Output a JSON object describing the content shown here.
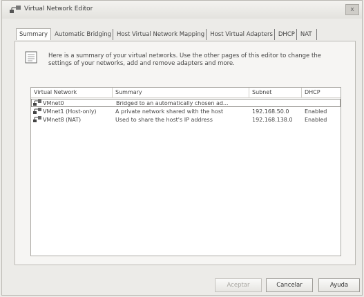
{
  "window": {
    "title": "Virtual Network Editor",
    "close_label": "x"
  },
  "tabs": [
    "Summary",
    "Automatic Bridging",
    "Host Virtual Network Mapping",
    "Host Virtual Adapters",
    "DHCP",
    "NAT"
  ],
  "intro": "Here is a summary of your virtual networks. Use the other pages of this editor to change the settings of your networks, add and remove adapters and more.",
  "table": {
    "headers": [
      "Virtual Network",
      "Summary",
      "Subnet",
      "DHCP"
    ],
    "rows": [
      [
        "VMnet0",
        "Bridged to an automatically chosen ad...",
        "",
        ""
      ],
      [
        "VMnet1 (Host-only)",
        "A private network shared with the host",
        "192.168.50.0",
        "Enabled"
      ],
      [
        "VMnet8 (NAT)",
        "Used to share the host's IP address",
        "192.168.138.0",
        "Enabled"
      ]
    ]
  },
  "buttons": {
    "accept": "Aceptar",
    "cancel": "Cancelar",
    "help": "Ayuda"
  }
}
